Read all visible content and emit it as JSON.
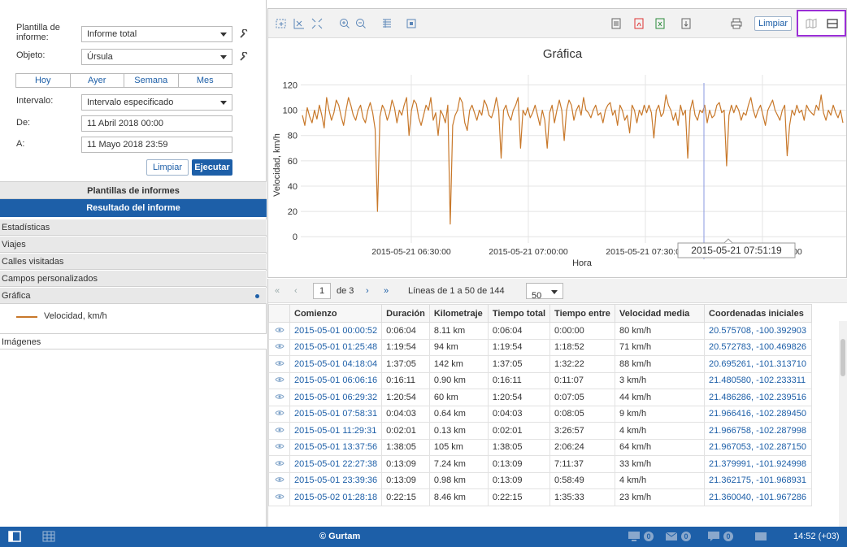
{
  "form": {
    "template_label": "Plantilla de informe:",
    "template_value": "Informe total",
    "object_label": "Objeto:",
    "object_value": "Úrsula",
    "period_buttons": [
      "Hoy",
      "Ayer",
      "Semana",
      "Mes"
    ],
    "interval_label": "Intervalo:",
    "interval_value": "Intervalo especificado",
    "from_label": "De:",
    "from_value": "11 Abril 2018 00:00",
    "to_label": "A:",
    "to_value": "11 Mayo 2018 23:59",
    "clear_button": "Limpiar",
    "run_button": "Ejecutar"
  },
  "panels": {
    "templates_header": "Plantillas de informes",
    "result_header": "Resultado del informe",
    "sections": [
      "Estadísticas",
      "Viajes",
      "Calles visitadas",
      "Campos personalizados",
      "Gráfica"
    ],
    "legend_item": "Velocidad, km/h",
    "images_section": "Imágenes"
  },
  "chart_toolbar": {
    "clear_button": "Limpiar"
  },
  "chart_data": {
    "type": "line",
    "title": "Gráfica",
    "xlabel": "Hora",
    "ylabel": "Velocidad, km/h",
    "yticks": [
      0,
      20,
      40,
      60,
      80,
      100,
      120
    ],
    "ylim": [
      -5,
      128
    ],
    "xticks": [
      "2015-05-21 06:30:00",
      "2015-05-21 07:00:00",
      "2015-05-21 07:30:00",
      "2015-05-21 08:00:00"
    ],
    "tooltip": "2015-05-21 07:51:19",
    "series": [
      {
        "name": "Velocidad, km/h",
        "color": "#c8782a",
        "values": [
          96,
          88,
          102,
          95,
          90,
          100,
          93,
          104,
          96,
          86,
          110,
          100,
          92,
          98,
          108,
          104,
          95,
          88,
          100,
          110,
          104,
          96,
          92,
          100,
          104,
          94,
          90,
          100,
          106,
          98,
          85,
          20,
          95,
          104,
          100,
          92,
          98,
          108,
          102,
          90,
          100,
          96,
          104,
          110,
          80,
          100,
          108,
          105,
          94,
          88,
          96,
          104,
          100,
          110,
          92,
          98,
          80,
          100,
          96,
          90,
          104,
          10,
          88,
          96,
          100,
          110,
          106,
          90,
          84,
          100,
          104,
          98,
          92,
          100,
          96,
          108,
          104,
          96,
          94,
          100,
          110,
          100,
          62,
          100,
          104,
          96,
          92,
          100,
          104,
          110,
          70,
          100,
          96,
          102,
          94,
          98,
          104,
          96,
          88,
          100,
          92,
          70,
          98,
          104,
          90,
          100,
          108,
          100,
          76,
          100,
          108,
          104,
          92,
          100,
          104,
          96,
          110,
          100,
          98,
          94,
          100,
          104,
          96,
          98,
          90,
          100,
          104,
          106,
          96,
          100,
          88,
          104,
          100,
          92,
          96,
          82,
          104,
          100,
          90,
          100,
          96,
          104,
          98,
          104,
          98,
          78,
          100,
          104,
          95,
          98,
          112,
          104,
          100,
          92,
          98,
          88,
          104,
          96,
          100,
          62,
          100,
          108,
          96,
          92,
          100,
          98,
          104,
          90,
          100,
          94,
          96,
          104,
          106,
          98,
          100,
          56,
          96,
          104,
          98,
          104,
          100,
          92,
          98,
          96,
          104,
          110,
          100,
          94,
          100,
          104,
          96,
          88,
          100,
          104,
          108,
          100,
          96,
          92,
          100,
          104,
          64,
          88,
          100,
          96,
          104,
          98,
          100,
          92,
          104,
          100,
          98,
          96,
          104,
          100,
          112,
          98,
          92,
          100,
          96,
          104,
          98,
          94,
          100,
          90
        ]
      }
    ]
  },
  "pager": {
    "current_page": "1",
    "of_pages": "de 3",
    "lines_text": "Líneas de 1 a 50 de 144",
    "page_size": "50"
  },
  "table": {
    "columns": [
      "Comienzo",
      "Duración",
      "Kilometraje",
      "Tiempo total",
      "Tiempo entre",
      "Velocidad media",
      "Coordenadas iniciales"
    ],
    "rows": [
      [
        "2015-05-01 00:00:52",
        "0:06:04",
        "8.11 km",
        "0:06:04",
        "0:00:00",
        "80 km/h",
        "20.575708, -100.392903"
      ],
      [
        "2015-05-01 01:25:48",
        "1:19:54",
        "94 km",
        "1:19:54",
        "1:18:52",
        "71 km/h",
        "20.572783, -100.469826"
      ],
      [
        "2015-05-01 04:18:04",
        "1:37:05",
        "142 km",
        "1:37:05",
        "1:32:22",
        "88 km/h",
        "20.695261, -101.313710"
      ],
      [
        "2015-05-01 06:06:16",
        "0:16:11",
        "0.90 km",
        "0:16:11",
        "0:11:07",
        "3 km/h",
        "21.480580, -102.233311"
      ],
      [
        "2015-05-01 06:29:32",
        "1:20:54",
        "60 km",
        "1:20:54",
        "0:07:05",
        "44 km/h",
        "21.486286, -102.239516"
      ],
      [
        "2015-05-01 07:58:31",
        "0:04:03",
        "0.64 km",
        "0:04:03",
        "0:08:05",
        "9 km/h",
        "21.966416, -102.289450"
      ],
      [
        "2015-05-01 11:29:31",
        "0:02:01",
        "0.13 km",
        "0:02:01",
        "3:26:57",
        "4 km/h",
        "21.966758, -102.287998"
      ],
      [
        "2015-05-01 13:37:56",
        "1:38:05",
        "105 km",
        "1:38:05",
        "2:06:24",
        "64 km/h",
        "21.967053, -102.287150"
      ],
      [
        "2015-05-01 22:27:38",
        "0:13:09",
        "7.24 km",
        "0:13:09",
        "7:11:37",
        "33 km/h",
        "21.379991, -101.924998"
      ],
      [
        "2015-05-01 23:39:36",
        "0:13:09",
        "0.98 km",
        "0:13:09",
        "0:58:49",
        "4 km/h",
        "21.362175, -101.968931"
      ],
      [
        "2015-05-02 01:28:18",
        "0:22:15",
        "8.46 km",
        "0:22:15",
        "1:35:33",
        "23 km/h",
        "21.360040, -101.967286"
      ]
    ]
  },
  "statusbar": {
    "copyright": "© Gurtam",
    "badge_a": "0",
    "badge_b": "0",
    "badge_c": "0",
    "clock": "14:52 (+03)"
  }
}
